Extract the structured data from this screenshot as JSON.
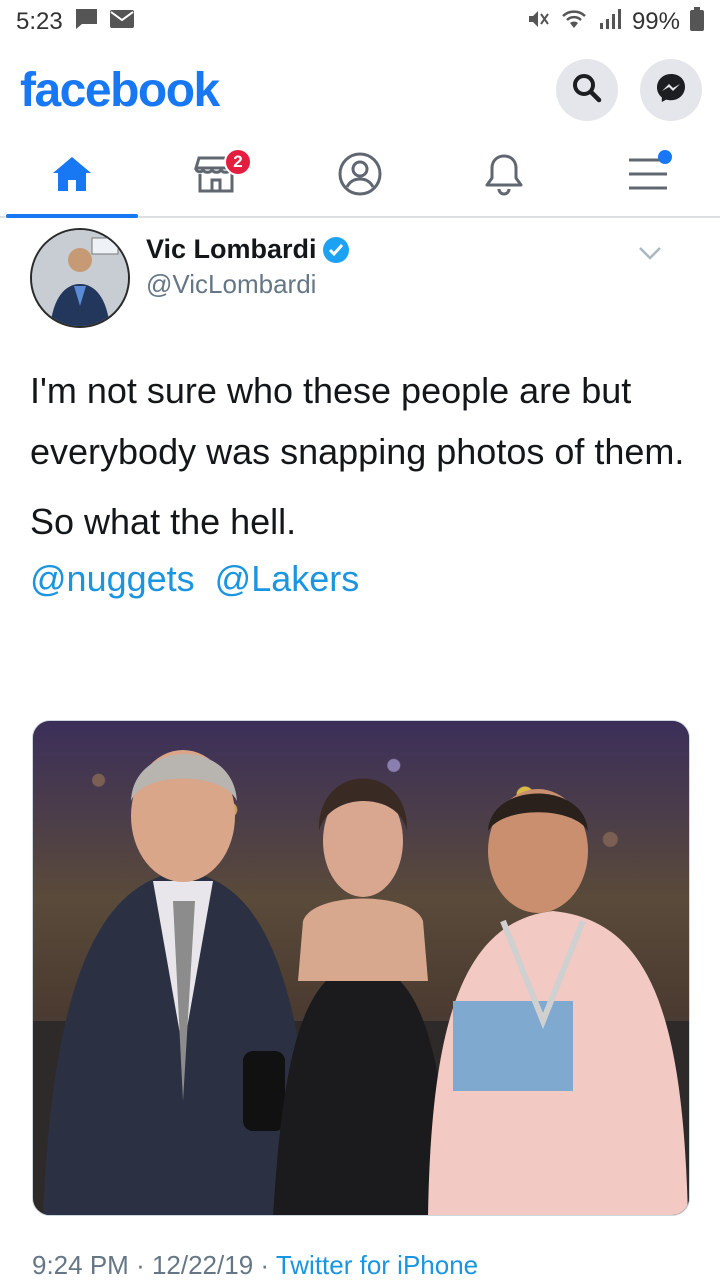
{
  "status_bar": {
    "time": "5:23",
    "battery": "99%"
  },
  "header": {
    "logo": "facebook",
    "search_icon": "search-icon",
    "messenger_icon": "messenger-icon"
  },
  "nav": {
    "tabs": [
      {
        "name": "home-icon",
        "active": true
      },
      {
        "name": "marketplace-icon",
        "badge": "2"
      },
      {
        "name": "profile-icon"
      },
      {
        "name": "notifications-bell-icon"
      },
      {
        "name": "menu-icon",
        "dot": true
      }
    ]
  },
  "tweet": {
    "author_name": "Vic Lombardi",
    "handle": "@VicLombardi",
    "paragraph_1": "I'm not sure who these people are but everybody was snapping photos of them.",
    "paragraph_2": "So what the hell.",
    "mentions": [
      "@nuggets",
      "@Lakers"
    ],
    "meta_time": "9:24 PM",
    "meta_date": "12/22/19",
    "meta_source": "Twitter for iPhone"
  },
  "colors": {
    "facebook_blue": "#1877f2",
    "twitter_link": "#1b95e0",
    "badge_red": "#e41e3f"
  }
}
